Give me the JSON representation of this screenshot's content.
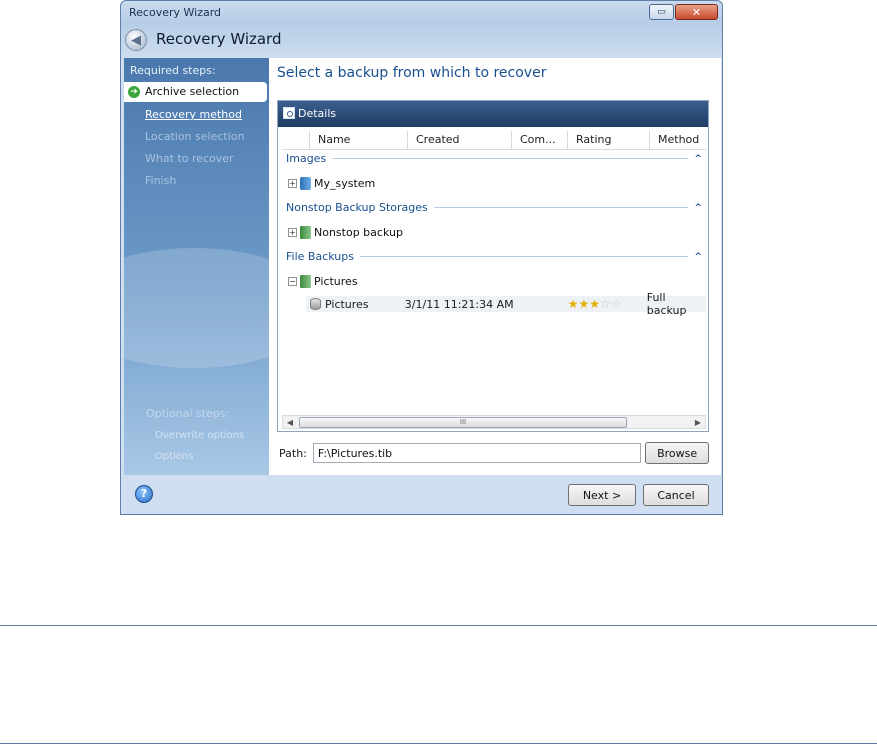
{
  "window": {
    "title": "Recovery Wizard",
    "min_glyph": "▭",
    "close_glyph": "✕"
  },
  "header": {
    "heading": "Recovery Wizard"
  },
  "sidebar": {
    "required_heading": "Required steps:",
    "items": [
      {
        "label": "Archive selection",
        "state": "active"
      },
      {
        "label": "Recovery method",
        "state": "link"
      },
      {
        "label": "Location selection",
        "state": "disabled"
      },
      {
        "label": "What to recover",
        "state": "disabled"
      },
      {
        "label": "Finish",
        "state": "disabled"
      }
    ],
    "optional_heading": "Optional steps:",
    "optional_items": [
      "Overwrite options",
      "Options"
    ]
  },
  "content": {
    "title": "Select a backup from which to recover",
    "details_label": "Details",
    "columns": [
      "Name",
      "Created",
      "Com...",
      "Rating",
      "Method"
    ],
    "groups": [
      {
        "label": "Images",
        "items": [
          "My_system"
        ]
      },
      {
        "label": "Nonstop Backup Storages",
        "items": [
          "Nonstop backup"
        ]
      },
      {
        "label": "File Backups",
        "items": [
          "Pictures"
        ]
      }
    ],
    "file_row": {
      "name": "Pictures",
      "created": "3/1/11 11:21:34 AM",
      "rating": 3,
      "rating_max": 5,
      "method": "Full backup"
    },
    "scroll_thumb_label": "III",
    "path_label": "Path:",
    "path_value": "F:\\Pictures.tib",
    "browse_label": "Browse"
  },
  "footer": {
    "next_label": "Next >",
    "cancel_label": "Cancel"
  }
}
